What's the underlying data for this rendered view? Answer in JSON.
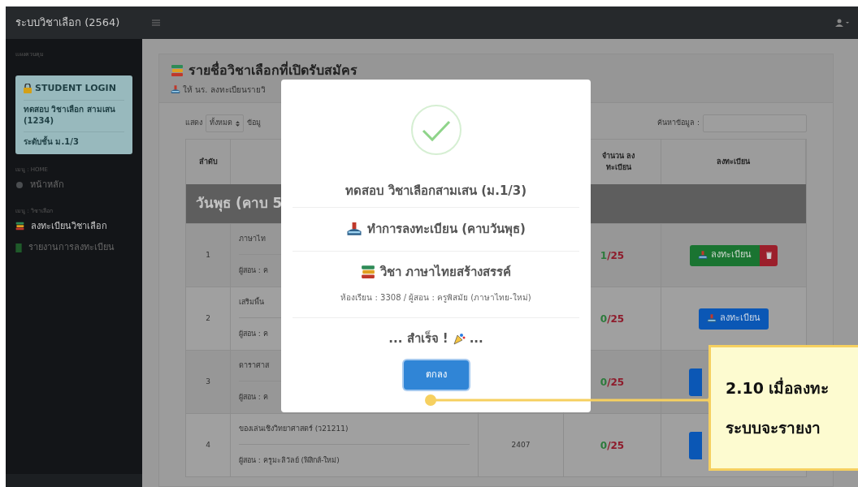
{
  "topbar": {
    "title": "ระบบวิชาเลือก (2564)"
  },
  "sidebar": {
    "heading": "แผงควบคุม",
    "login": {
      "title": "STUDENT LOGIN",
      "name": "ทดสอบ วิชาเลือก สามเสน (1234)",
      "level": "ระดับชั้น ม.1/3"
    },
    "sections": [
      {
        "label": "เมนู : HOME",
        "items": [
          {
            "label": "หน้าหลัก",
            "kind": "home",
            "selected": false
          }
        ]
      },
      {
        "label": "เมนู : วิชาเลือก",
        "items": [
          {
            "label": "ลงทะเบียนวิชาเลือก",
            "kind": "books",
            "selected": true
          },
          {
            "label": "รายงานการลงทะเบียน",
            "kind": "book",
            "selected": false
          }
        ]
      }
    ]
  },
  "card": {
    "title": "รายชื่อวิชาเลือกที่เปิดรับสมัคร",
    "subtitle": "ให้ นร. ลงทะเบียนรายวิ",
    "show_label": "แสดง",
    "show_value": "ทั้งหมด",
    "after_show": "ข้อมู",
    "search_label": "ค้นหาข้อมูล :"
  },
  "table": {
    "columns": [
      "ลำดับ",
      "",
      "",
      "จำนวน ลงทะเบียน",
      "ลงทะเบียน"
    ],
    "group": "วันพุธ (คาบ 5",
    "rows": [
      {
        "no": "1",
        "subject": "ภาษาไท",
        "teacher": "ผู้สอน : ค",
        "registered": "1",
        "limit": "/25",
        "action": {
          "kind": "registered",
          "label": "ลงทะเบียน"
        }
      },
      {
        "no": "2",
        "subject": "เสริมพื้น",
        "teacher": "ผู้สอน : ค",
        "registered": "0",
        "limit": "/25",
        "action": {
          "kind": "open",
          "label": "ลงทะเบียน"
        }
      },
      {
        "no": "3",
        "subject": "ดาราศาส",
        "teacher": "ผู้สอน : ค",
        "registered": "0",
        "limit": "/25",
        "action": {
          "kind": "covered"
        }
      },
      {
        "no": "4",
        "subject": "ของเล่นเชิงวิทยาศาสตร์ (ว21211)",
        "teacher": "ผู้สอน : ครูมะลิวัลย์ (ฟิสิกส์-ใหม่)",
        "room": "2407",
        "registered": "0",
        "limit": "/25",
        "action": {
          "kind": "covered"
        }
      }
    ]
  },
  "modal": {
    "student": "ทดสอบ วิชาเลือกสามเสน (ม.1/3)",
    "action": "ทำการลงทะเบียน (คาบวันพุธ)",
    "subject": "วิชา ภาษาไทยสร้างสรรค์",
    "detail": "ห้องเรียน : 3308 / ผู้สอน : ครูพิสมัย (ภาษาไทย-ใหม่)",
    "result_before": "... สำเร็จ !",
    "result_after": "...",
    "button": "ตกลง"
  },
  "callout": {
    "lines": [
      "2.10 เมื่อลงทะ",
      "ระบบจะรายงา"
    ]
  }
}
